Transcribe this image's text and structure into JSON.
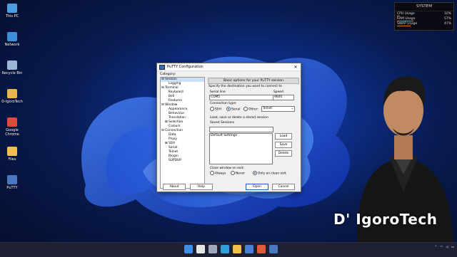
{
  "desktop": {
    "icons": [
      {
        "label": "This PC",
        "color": "#4a9fe0"
      },
      {
        "label": "Network",
        "color": "#3a8fd8"
      },
      {
        "label": "Recycle Bin",
        "color": "#9ab8d6"
      },
      {
        "label": "D-IgoroTech",
        "color": "#e8b64a"
      },
      {
        "label": "Google Chrome",
        "color": "#e04a3a"
      },
      {
        "label": "Files",
        "color": "#f0c04a"
      },
      {
        "label": "PuTTY",
        "color": "#4a78c0"
      }
    ]
  },
  "system_monitor": {
    "title": "SYSTEM",
    "rows": [
      {
        "label": "CPU Usage",
        "value": "10%",
        "fraction": 0.1
      },
      {
        "label": "RAM Usage",
        "value": "57%",
        "fraction": 0.57
      },
      {
        "label": "SWAP Usage",
        "value": "47%",
        "fraction": 0.47
      }
    ]
  },
  "putty": {
    "title": "PuTTY Configuration",
    "close": "✕",
    "category_label": "Category:",
    "tree": [
      {
        "text": "⊟ Session",
        "indent": 0
      },
      {
        "text": "Logging",
        "indent": 2
      },
      {
        "text": "⊟ Terminal",
        "indent": 0
      },
      {
        "text": "Keyboard",
        "indent": 2
      },
      {
        "text": "Bell",
        "indent": 2
      },
      {
        "text": "Features",
        "indent": 2
      },
      {
        "text": "⊟ Window",
        "indent": 0
      },
      {
        "text": "Appearance",
        "indent": 2
      },
      {
        "text": "Behaviour",
        "indent": 2
      },
      {
        "text": "Translation",
        "indent": 2
      },
      {
        "text": "⊞ Selection",
        "indent": 1
      },
      {
        "text": "Colours",
        "indent": 2
      },
      {
        "text": "⊟ Connection",
        "indent": 0
      },
      {
        "text": "Data",
        "indent": 2
      },
      {
        "text": "Proxy",
        "indent": 2
      },
      {
        "text": "⊞ SSH",
        "indent": 1
      },
      {
        "text": "Serial",
        "indent": 2
      },
      {
        "text": "Telnet",
        "indent": 2
      },
      {
        "text": "Rlogin",
        "indent": 2
      },
      {
        "text": "SUPDUP",
        "indent": 2
      }
    ],
    "panel_header": "Basic options for your PuTTY session",
    "dest_label": "Specify the destination you want to connect to",
    "serial_line_label": "Serial line",
    "serial_line_value": "COM5",
    "speed_label": "Speed",
    "speed_value": "9600",
    "conn_type_label": "Connection type:",
    "conn_types": [
      "SSH",
      "Serial",
      "Other:"
    ],
    "other_value": "Telnet",
    "load_save_label": "Load, save or delete a stored session",
    "saved_sessions_label": "Saved Sessions",
    "sessions": [
      "Default Settings"
    ],
    "btn_load": "Load",
    "btn_save": "Save",
    "btn_delete": "Delete",
    "close_exit_label": "Close window on exit:",
    "exit_options": [
      "Always",
      "Never",
      "Only on clean exit"
    ],
    "btn_about": "About",
    "btn_help": "Help",
    "btn_open": "Open",
    "btn_cancel": "Cancel"
  },
  "watermark": "D' IgoroTech",
  "taskbar": {
    "icons": [
      "windows-icon",
      "search-icon",
      "task-view-icon",
      "edge-icon",
      "file-explorer-icon",
      "store-icon",
      "app-icon",
      "putty-icon"
    ]
  }
}
